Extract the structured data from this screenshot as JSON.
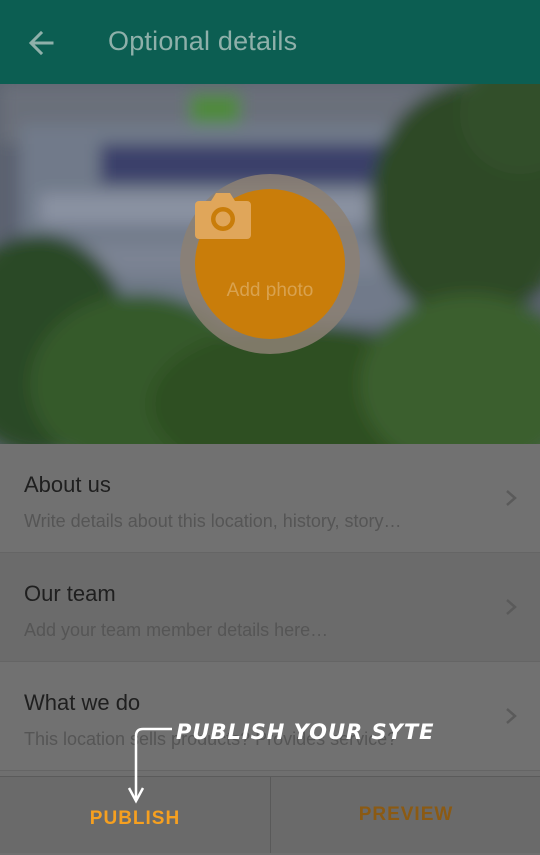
{
  "appbar": {
    "title": "Optional details",
    "back_icon": "arrow-back-icon",
    "color": "#0c5e52"
  },
  "hero": {
    "add_photo_label": "Add photo",
    "camera_icon": "camera-icon",
    "accent": "#c97d0a"
  },
  "list": {
    "items": [
      {
        "title": "About us",
        "subtitle": "Write details about this location, history, story…"
      },
      {
        "title": "Our team",
        "subtitle": "Add your team member details here…"
      },
      {
        "title": "What we do",
        "subtitle": "This location sells products? Provides service?"
      }
    ]
  },
  "bottom": {
    "publish_label": "PUBLISH",
    "preview_label": "PREVIEW"
  },
  "callout": {
    "text": "PUBLISH YOUR SYTE"
  }
}
